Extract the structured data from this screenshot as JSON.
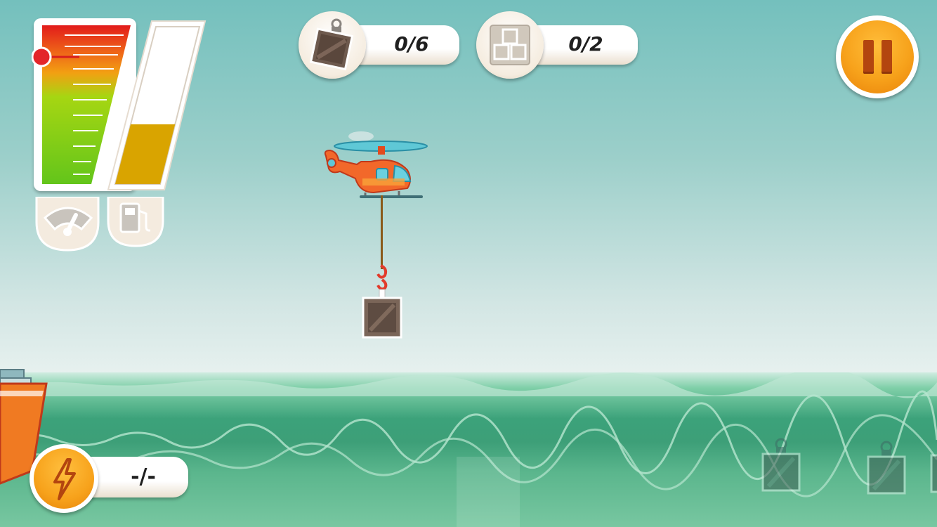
{
  "hud": {
    "crates_delivered": "0/6",
    "stacks_completed": "0/2",
    "boost_counter": "-/-",
    "speed_level": 0.8,
    "fuel_level": 0.38
  },
  "icons": {
    "crates_badge": "crate-icon",
    "stacks_badge": "crate-stack-icon",
    "speed_badge": "speedometer-icon",
    "fuel_badge": "fuel-pump-icon",
    "pause": "pause-icon",
    "boost": "lightning-icon"
  },
  "colors": {
    "pause_orange": "#f7a21b",
    "boost_orange": "#f7a21b",
    "helicopter_body": "#f2682a",
    "fuel_fill": "#d9a400"
  }
}
